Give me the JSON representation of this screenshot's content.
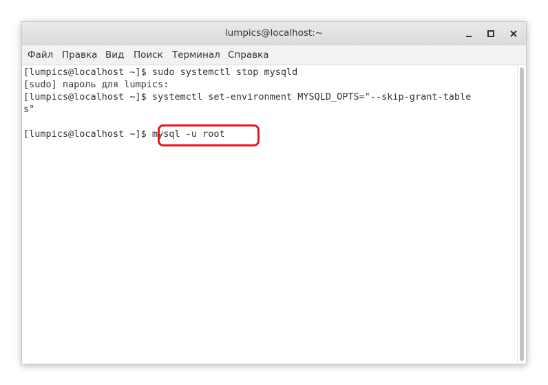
{
  "window": {
    "title": "lumpics@localhost:~",
    "controls": {
      "minimize": "–",
      "maximize": "□",
      "close": "✕"
    }
  },
  "menubar": {
    "items": [
      "Файл",
      "Правка",
      "Вид",
      "Поиск",
      "Терминал",
      "Справка"
    ]
  },
  "terminal": {
    "lines": [
      "[lumpics@localhost ~]$ sudo systemctl stop mysqld",
      "[sudo] пароль для lumpics:",
      "[lumpics@localhost ~]$ systemctl set-environment MYSQLD_OPTS=\"--skip-grant-table",
      "s\"",
      "",
      "[lumpics@localhost ~]$ mysql -u root"
    ],
    "highlighted_command": "mysql -u root"
  },
  "colors": {
    "highlight": "#e2161b",
    "text": "#2e3436"
  }
}
